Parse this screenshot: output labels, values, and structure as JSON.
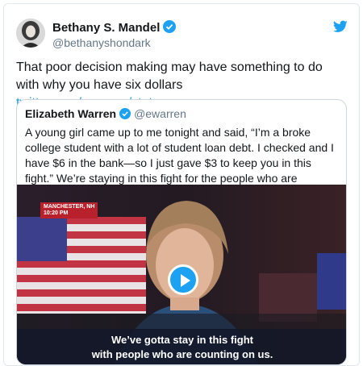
{
  "tweet": {
    "author_name": "Bethany S. Mandel",
    "author_handle": "@bethanyshondark",
    "text": "That poor decision making may have something to do with why you have six dollars ",
    "link_text": "twitter.com/ewarren/status…"
  },
  "quoted_tweet": {
    "author_name": "Elizabeth Warren",
    "author_handle": "@ewarren",
    "text": "A young girl came up to me tonight and said, “I’m a broke college student with a lot of student loan debt. I checked and I have $6 in the bank—so I just gave $3 to keep you in this fight.” We’re staying in this fight for the people who are counting on us.",
    "video": {
      "location_line1": "MANCHESTER, NH",
      "location_line2": "10:20 PM",
      "caption_line1": "We’ve gotta stay in this fight",
      "caption_line2": "with people who are counting on us."
    }
  },
  "colors": {
    "verified": "#1da1f2",
    "link": "#1b95e0",
    "twitter_blue": "#1da1f2",
    "badge_red": "#b8202b"
  },
  "icons": [
    "verified-badge-icon",
    "twitter-bird-icon",
    "play-icon"
  ]
}
